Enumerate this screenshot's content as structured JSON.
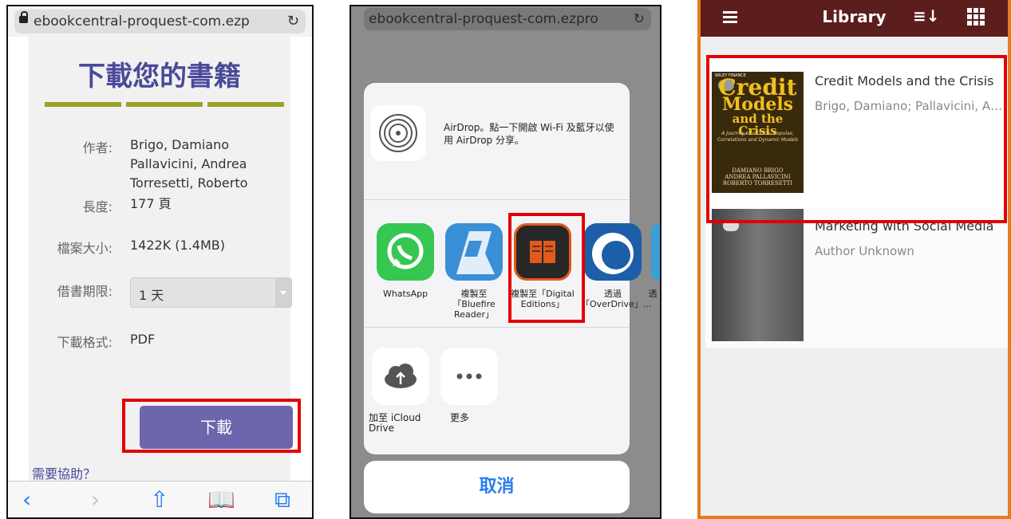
{
  "panel1": {
    "url": "ebookcentral-proquest-com.ezp",
    "title": "下載您的書籍",
    "rows": [
      {
        "label": "作者:",
        "value": "Brigo, Damiano Pallavicini, Andrea Torresetti, Roberto"
      },
      {
        "label": "長度:",
        "value": "177 頁"
      },
      {
        "label": "檔案大小:",
        "value": "1422K (1.4MB)"
      },
      {
        "label": "借書期限:",
        "value": "1 天"
      },
      {
        "label": "下載格式:",
        "value": "PDF"
      }
    ],
    "download_button": "下載",
    "help_link": "需要協助？",
    "toolbar_icons": [
      "back-icon",
      "forward-icon",
      "share-icon",
      "bookmarks-icon",
      "tabs-icon"
    ],
    "accent_color": "#6d66ad"
  },
  "panel2": {
    "url": "ebookcentral-proquest-com.ezpro",
    "airdrop_text": "AirDrop。點一下開啟 Wi-Fi 及藍牙以使用 AirDrop 分享。",
    "apps": [
      {
        "name": "whatsapp-icon",
        "label": "WhatsApp"
      },
      {
        "name": "bluefire-icon",
        "label": "複製至「Bluefire Reader」"
      },
      {
        "name": "digital-editions-icon",
        "label": "複製至「Digital Editions」"
      },
      {
        "name": "overdrive-icon",
        "label": "透過「OverDrive」..."
      },
      {
        "name": "more-app-icon",
        "label": "透"
      }
    ],
    "actions": [
      {
        "name": "icloud-icon",
        "label": "加至 iCloud Drive"
      },
      {
        "name": "more-icon",
        "label": "更多"
      }
    ],
    "cancel": "取消"
  },
  "panel3": {
    "title": "Library",
    "books": [
      {
        "title": "Credit Models and the Crisis",
        "author": "Brigo, Damiano; Pallavicini, Andrea; Torresetti, Roberto",
        "cover": {
          "publisher": "WILEY FINANCE",
          "lines": [
            "Credit",
            "Models",
            "and the Crisis"
          ],
          "subtitle": "A Journey into CDOs, Copulas, Correlations and Dynamic Models",
          "authors": [
            "DAMIANO BRIGO",
            "ANDREA PALLAVICINI",
            "ROBERTO TORRESETTI"
          ]
        }
      },
      {
        "title": "Marketing with Social Media",
        "author": "Author Unknown"
      }
    ],
    "bar_color": "#5c1d1d",
    "frame_color": "#e57d1a"
  },
  "highlight_color": "#e30000"
}
